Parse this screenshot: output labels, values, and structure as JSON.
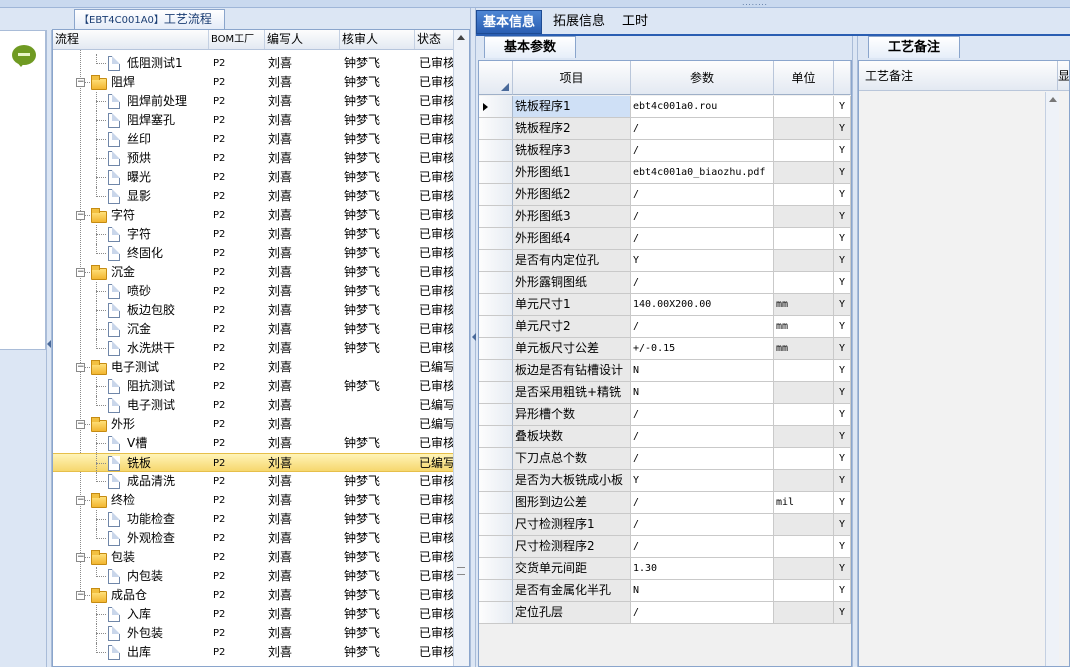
{
  "top": {
    "grip": "........"
  },
  "process_tab": {
    "code": "【EBT4C001A0】",
    "label": "工艺流程"
  },
  "tree": {
    "columns": [
      "流程",
      "BOM工厂",
      "编写人",
      "核审人",
      "状态"
    ],
    "rows": [
      {
        "name": "低阻测试1",
        "level": 1,
        "type": "doc",
        "bom": "P2",
        "writer": "刘喜",
        "reviewer": "钟梦飞",
        "status": "已审核"
      },
      {
        "name": "阻焊",
        "level": 0,
        "type": "folder",
        "bom": "P2",
        "writer": "刘喜",
        "reviewer": "钟梦飞",
        "status": "已审核"
      },
      {
        "name": "阻焊前处理",
        "level": 1,
        "type": "doc",
        "bom": "P2",
        "writer": "刘喜",
        "reviewer": "钟梦飞",
        "status": "已审核"
      },
      {
        "name": "阻焊塞孔",
        "level": 1,
        "type": "doc",
        "bom": "P2",
        "writer": "刘喜",
        "reviewer": "钟梦飞",
        "status": "已审核"
      },
      {
        "name": "丝印",
        "level": 1,
        "type": "doc",
        "bom": "P2",
        "writer": "刘喜",
        "reviewer": "钟梦飞",
        "status": "已审核"
      },
      {
        "name": "预烘",
        "level": 1,
        "type": "doc",
        "bom": "P2",
        "writer": "刘喜",
        "reviewer": "钟梦飞",
        "status": "已审核"
      },
      {
        "name": "曝光",
        "level": 1,
        "type": "doc",
        "bom": "P2",
        "writer": "刘喜",
        "reviewer": "钟梦飞",
        "status": "已审核"
      },
      {
        "name": "显影",
        "level": 1,
        "type": "doc",
        "bom": "P2",
        "writer": "刘喜",
        "reviewer": "钟梦飞",
        "status": "已审核"
      },
      {
        "name": "字符",
        "level": 0,
        "type": "folder",
        "bom": "P2",
        "writer": "刘喜",
        "reviewer": "钟梦飞",
        "status": "已审核"
      },
      {
        "name": "字符",
        "level": 1,
        "type": "doc",
        "bom": "P2",
        "writer": "刘喜",
        "reviewer": "钟梦飞",
        "status": "已审核"
      },
      {
        "name": "终固化",
        "level": 1,
        "type": "doc",
        "bom": "P2",
        "writer": "刘喜",
        "reviewer": "钟梦飞",
        "status": "已审核"
      },
      {
        "name": "沉金",
        "level": 0,
        "type": "folder",
        "bom": "P2",
        "writer": "刘喜",
        "reviewer": "钟梦飞",
        "status": "已审核"
      },
      {
        "name": "喷砂",
        "level": 1,
        "type": "doc",
        "bom": "P2",
        "writer": "刘喜",
        "reviewer": "钟梦飞",
        "status": "已审核"
      },
      {
        "name": "板边包胶",
        "level": 1,
        "type": "doc",
        "bom": "P2",
        "writer": "刘喜",
        "reviewer": "钟梦飞",
        "status": "已审核"
      },
      {
        "name": "沉金",
        "level": 1,
        "type": "doc",
        "bom": "P2",
        "writer": "刘喜",
        "reviewer": "钟梦飞",
        "status": "已审核"
      },
      {
        "name": "水洗烘干",
        "level": 1,
        "type": "doc",
        "bom": "P2",
        "writer": "刘喜",
        "reviewer": "钟梦飞",
        "status": "已审核"
      },
      {
        "name": "电子测试",
        "level": 0,
        "type": "folder",
        "bom": "P2",
        "writer": "刘喜",
        "reviewer": "",
        "status": "已编写"
      },
      {
        "name": "阻抗测试",
        "level": 1,
        "type": "doc",
        "bom": "P2",
        "writer": "刘喜",
        "reviewer": "钟梦飞",
        "status": "已审核"
      },
      {
        "name": "电子测试",
        "level": 1,
        "type": "doc",
        "bom": "P2",
        "writer": "刘喜",
        "reviewer": "",
        "status": "已编写"
      },
      {
        "name": "外形",
        "level": 0,
        "type": "folder",
        "bom": "P2",
        "writer": "刘喜",
        "reviewer": "",
        "status": "已编写"
      },
      {
        "name": "V槽",
        "level": 1,
        "type": "doc",
        "bom": "P2",
        "writer": "刘喜",
        "reviewer": "钟梦飞",
        "status": "已审核"
      },
      {
        "name": "铣板",
        "level": 1,
        "type": "doc",
        "bom": "P2",
        "writer": "刘喜",
        "reviewer": "",
        "status": "已编写",
        "selected": true
      },
      {
        "name": "成品清洗",
        "level": 1,
        "type": "doc",
        "bom": "P2",
        "writer": "刘喜",
        "reviewer": "钟梦飞",
        "status": "已审核"
      },
      {
        "name": "终检",
        "level": 0,
        "type": "folder",
        "bom": "P2",
        "writer": "刘喜",
        "reviewer": "钟梦飞",
        "status": "已审核"
      },
      {
        "name": "功能检查",
        "level": 1,
        "type": "doc",
        "bom": "P2",
        "writer": "刘喜",
        "reviewer": "钟梦飞",
        "status": "已审核"
      },
      {
        "name": "外观检查",
        "level": 1,
        "type": "doc",
        "bom": "P2",
        "writer": "刘喜",
        "reviewer": "钟梦飞",
        "status": "已审核"
      },
      {
        "name": "包装",
        "level": 0,
        "type": "folder",
        "bom": "P2",
        "writer": "刘喜",
        "reviewer": "钟梦飞",
        "status": "已审核"
      },
      {
        "name": "内包装",
        "level": 1,
        "type": "doc",
        "bom": "P2",
        "writer": "刘喜",
        "reviewer": "钟梦飞",
        "status": "已审核"
      },
      {
        "name": "成品仓",
        "level": 0,
        "type": "folder",
        "bom": "P2",
        "writer": "刘喜",
        "reviewer": "钟梦飞",
        "status": "已审核"
      },
      {
        "name": "入库",
        "level": 1,
        "type": "doc",
        "bom": "P2",
        "writer": "刘喜",
        "reviewer": "钟梦飞",
        "status": "已审核"
      },
      {
        "name": "外包装",
        "level": 1,
        "type": "doc",
        "bom": "P2",
        "writer": "刘喜",
        "reviewer": "钟梦飞",
        "status": "已审核"
      },
      {
        "name": "出库",
        "level": 1,
        "type": "doc",
        "bom": "P2",
        "writer": "刘喜",
        "reviewer": "钟梦飞",
        "status": "已审核"
      }
    ]
  },
  "main_tabs": [
    "基本信息",
    "拓展信息",
    "工时"
  ],
  "sub_tabs": {
    "params": "基本参数",
    "remarks": "工艺备注"
  },
  "grid": {
    "columns": [
      "项目",
      "参数",
      "单位"
    ],
    "rows": [
      {
        "item": "铣板程序1",
        "value": "ebt4c001a0.rou",
        "unit": "",
        "flag": "Y",
        "current": true
      },
      {
        "item": "铣板程序2",
        "value": "/",
        "unit": "",
        "flag": "Y"
      },
      {
        "item": "铣板程序3",
        "value": "/",
        "unit": "",
        "flag": "Y"
      },
      {
        "item": "外形图纸1",
        "value": "ebt4c001a0_biaozhu.pdf",
        "unit": "",
        "flag": "Y"
      },
      {
        "item": "外形图纸2",
        "value": "/",
        "unit": "",
        "flag": "Y"
      },
      {
        "item": "外形图纸3",
        "value": "/",
        "unit": "",
        "flag": "Y"
      },
      {
        "item": "外形图纸4",
        "value": "/",
        "unit": "",
        "flag": "Y"
      },
      {
        "item": "是否有内定位孔",
        "value": "Y",
        "unit": "",
        "flag": "Y"
      },
      {
        "item": "外形露铜图纸",
        "value": "/",
        "unit": "",
        "flag": "Y"
      },
      {
        "item": "单元尺寸1",
        "value": "140.00X200.00",
        "unit": "mm",
        "flag": "Y"
      },
      {
        "item": "单元尺寸2",
        "value": "/",
        "unit": "mm",
        "flag": "Y"
      },
      {
        "item": "单元板尺寸公差",
        "value": "+/-0.15",
        "unit": "mm",
        "flag": "Y"
      },
      {
        "item": "板边是否有钻槽设计",
        "value": "N",
        "unit": "",
        "flag": "Y"
      },
      {
        "item": "是否采用粗铣+精铣",
        "value": "N",
        "unit": "",
        "flag": "Y"
      },
      {
        "item": "异形槽个数",
        "value": "/",
        "unit": "",
        "flag": "Y"
      },
      {
        "item": "叠板块数",
        "value": "/",
        "unit": "",
        "flag": "Y"
      },
      {
        "item": "下刀点总个数",
        "value": "/",
        "unit": "",
        "flag": "Y"
      },
      {
        "item": "是否为大板铣成小板",
        "value": "Y",
        "unit": "",
        "flag": "Y"
      },
      {
        "item": "图形到边公差",
        "value": "/",
        "unit": "mil",
        "flag": "Y"
      },
      {
        "item": "尺寸检测程序1",
        "value": "/",
        "unit": "",
        "flag": "Y"
      },
      {
        "item": "尺寸检测程序2",
        "value": "/",
        "unit": "",
        "flag": "Y"
      },
      {
        "item": "交货单元间距",
        "value": "1.30",
        "unit": "",
        "flag": "Y"
      },
      {
        "item": "是否有金属化半孔",
        "value": "N",
        "unit": "",
        "flag": "Y"
      },
      {
        "item": "定位孔层",
        "value": "/",
        "unit": "",
        "flag": "Y"
      }
    ]
  },
  "remarks": {
    "header": "工艺备注",
    "header2": "显"
  },
  "icons": {
    "chat": "chat-bubble-icon",
    "folder": "folder-icon",
    "doc": "document-icon",
    "row_pointer": "row-pointer-icon"
  }
}
